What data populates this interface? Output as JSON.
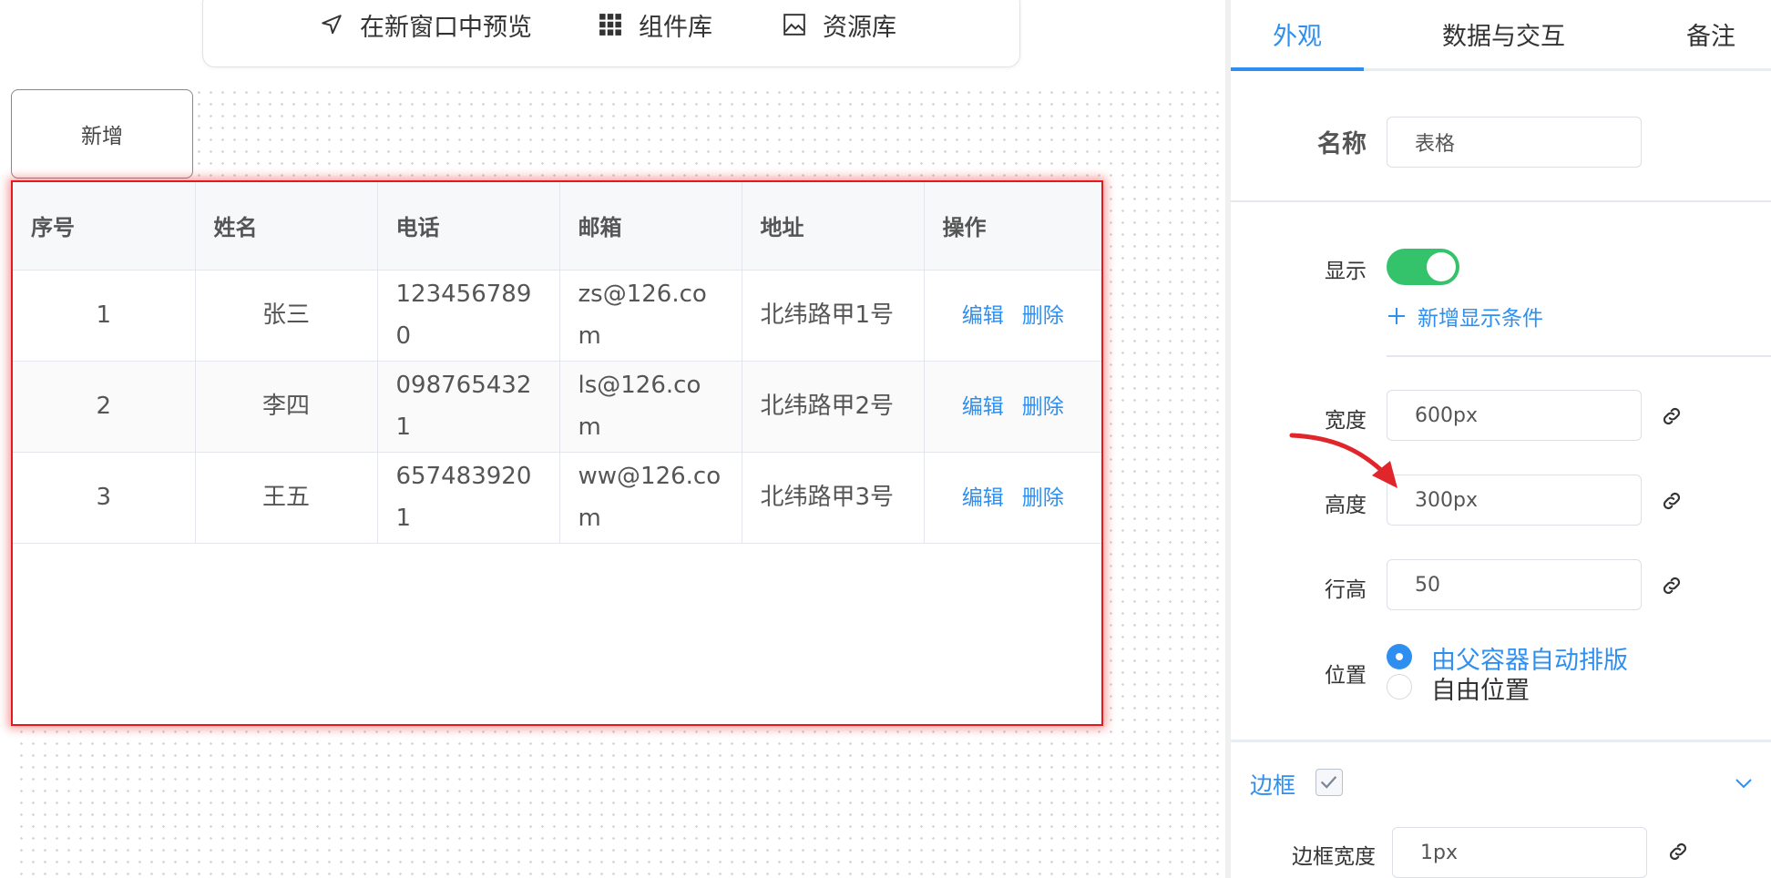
{
  "toolbar": {
    "preview_label": "在新窗口中预览",
    "components_label": "组件库",
    "resources_label": "资源库"
  },
  "canvas": {
    "add_button_label": "新增",
    "table": {
      "columns": [
        "序号",
        "姓名",
        "电话",
        "邮箱",
        "地址",
        "操作"
      ],
      "rows": [
        {
          "index": "1",
          "name": "张三",
          "phone": "1234567890",
          "email": "zs@126.com",
          "address": "北纬路甲1号"
        },
        {
          "index": "2",
          "name": "李四",
          "phone": "0987654321",
          "email": "ls@126.com",
          "address": "北纬路甲2号"
        },
        {
          "index": "3",
          "name": "王五",
          "phone": "6574839201",
          "email": "ww@126.com",
          "address": "北纬路甲3号"
        }
      ],
      "edit_label": "编辑",
      "delete_label": "删除"
    }
  },
  "panel": {
    "tabs": [
      {
        "label": "外观",
        "active": true
      },
      {
        "label": "数据与交互",
        "active": false
      },
      {
        "label": "备注",
        "active": false
      }
    ],
    "name_label": "名称",
    "name_value": "表格",
    "visible_label": "显示",
    "visible_on": true,
    "add_condition_label": "新增显示条件",
    "width_label": "宽度",
    "width_value": "600px",
    "height_label": "高度",
    "height_value": "300px",
    "row_height_label": "行高",
    "row_height_value": "50",
    "position_label": "位置",
    "position_options": [
      {
        "label": "由父容器自动排版",
        "selected": true
      },
      {
        "label": "自由位置",
        "selected": false
      }
    ],
    "border_section_label": "边框",
    "border_checked": true,
    "border_width_label": "边框宽度",
    "border_width_value": "1px"
  },
  "colors": {
    "accent": "#2f8ff0",
    "toggle_on": "#34c26b",
    "selection_border": "#e8171b",
    "annotation_arrow": "#e0262b"
  }
}
